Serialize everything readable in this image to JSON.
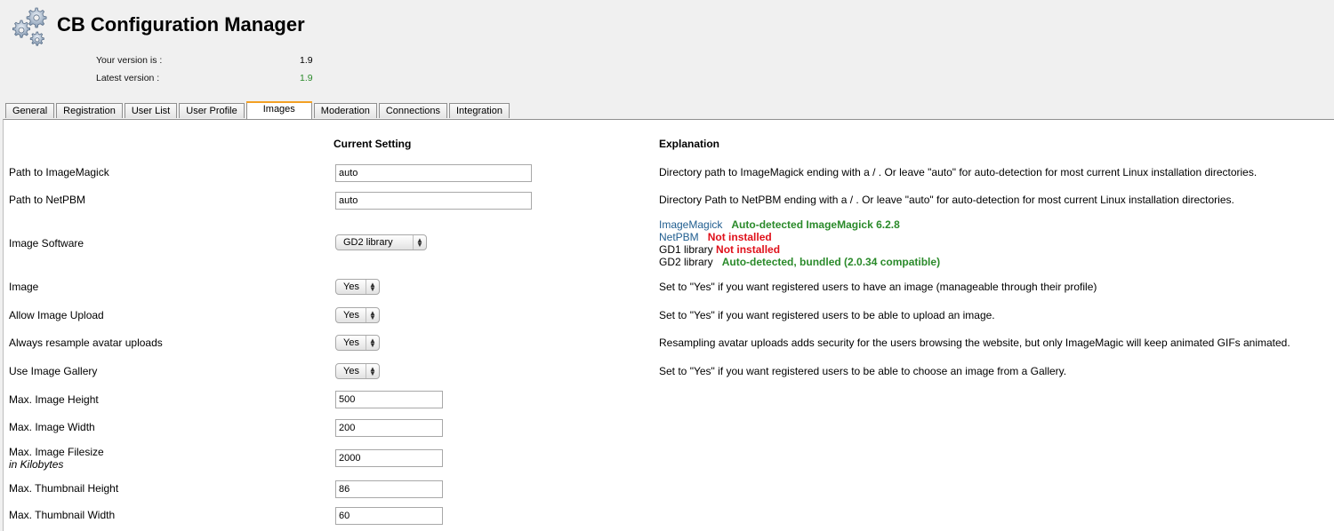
{
  "app": {
    "title": "CB Configuration Manager",
    "logo_icon": "gears-icon"
  },
  "version": {
    "your_label": "Your version is :",
    "your_value": "1.9",
    "latest_label": "Latest version :",
    "latest_value": "1.9",
    "latest_color": "#2a8a2a"
  },
  "tabs": [
    {
      "label": "General"
    },
    {
      "label": "Registration"
    },
    {
      "label": "User List"
    },
    {
      "label": "User Profile"
    },
    {
      "label": "Images",
      "active": true
    },
    {
      "label": "Moderation"
    },
    {
      "label": "Connections"
    },
    {
      "label": "Integration"
    }
  ],
  "columns": {
    "current": "Current Setting",
    "explanation": "Explanation"
  },
  "rows": {
    "imagemagick_path": {
      "label": "Path to ImageMagick",
      "value": "auto",
      "explanation": "Directory path to ImageMagick ending with a / . Or leave \"auto\" for auto-detection for most current Linux installation directories."
    },
    "netpbm_path": {
      "label": "Path to NetPBM",
      "value": "auto",
      "explanation": "Directory Path to NetPBM ending with a / . Or leave \"auto\" for auto-detection for most current Linux installation directories."
    },
    "image_software": {
      "label": "Image Software",
      "value": "GD2 library",
      "status": [
        {
          "name": "ImageMagick",
          "status": "Auto-detected ImageMagick 6.2.8",
          "ok": true
        },
        {
          "name": "NetPBM",
          "status": "Not installed",
          "ok": false
        },
        {
          "name": "GD1 library",
          "status": "Not installed",
          "ok": false
        },
        {
          "name": "GD2 library",
          "status": "Auto-detected, bundled (2.0.34 compatible)",
          "ok": true
        }
      ]
    },
    "image": {
      "label": "Image",
      "value": "Yes",
      "explanation": "Set to \"Yes\" if you want registered users to have an image (manageable through their profile)"
    },
    "allow_upload": {
      "label": "Allow Image Upload",
      "value": "Yes",
      "explanation": "Set to \"Yes\" if you want registered users to be able to upload an image."
    },
    "resample": {
      "label": "Always resample avatar uploads",
      "value": "Yes",
      "explanation": "Resampling avatar uploads adds security for the users browsing the website, but only ImageMagic will keep animated GIFs animated."
    },
    "gallery": {
      "label": "Use Image Gallery",
      "value": "Yes",
      "explanation": "Set to \"Yes\" if you want registered users to be able to choose an image from a Gallery."
    },
    "max_height": {
      "label": "Max. Image Height",
      "value": "500"
    },
    "max_width": {
      "label": "Max. Image Width",
      "value": "200"
    },
    "max_filesize": {
      "label": "Max. Image Filesize",
      "sublabel": "in Kilobytes",
      "value": "2000"
    },
    "thumb_height": {
      "label": "Max. Thumbnail Height",
      "value": "86"
    },
    "thumb_width": {
      "label": "Max. Thumbnail Width",
      "value": "60"
    }
  }
}
